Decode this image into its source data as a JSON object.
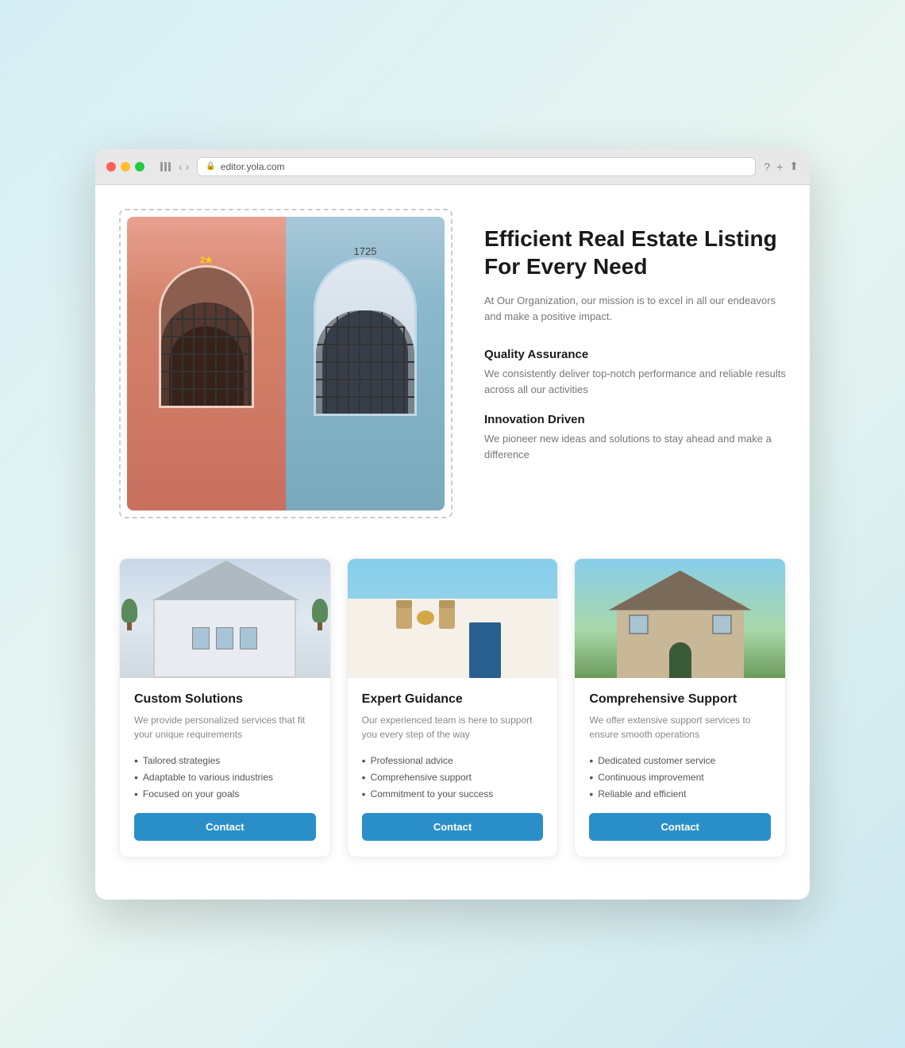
{
  "browser": {
    "url": "editor.yola.com"
  },
  "hero": {
    "title": "Efficient Real Estate Listing For Every Need",
    "subtitle": "At Our Organization, our mission is to excel in all our endeavors and make a positive impact.",
    "feature1": {
      "title": "Quality Assurance",
      "desc": "We consistently deliver top-notch performance and reliable results across all our activities"
    },
    "feature2": {
      "title": "Innovation Driven",
      "desc": "We pioneer new ideas and solutions to stay ahead and make a difference"
    },
    "door_number_right": "1725"
  },
  "cards": [
    {
      "title": "Custom Solutions",
      "desc": "We provide personalized services that fit your unique requirements",
      "items": [
        "Tailored strategies",
        "Adaptable to various industries",
        "Focused on your goals"
      ],
      "btn": "Contact"
    },
    {
      "title": "Expert Guidance",
      "desc": "Our experienced team is here to support you every step of the way",
      "items": [
        "Professional advice",
        "Comprehensive support",
        "Commitment to your success"
      ],
      "btn": "Contact"
    },
    {
      "title": "Comprehensive Support",
      "desc": "We offer extensive support services to ensure smooth operations",
      "items": [
        "Dedicated customer service",
        "Continuous improvement",
        "Reliable and efficient"
      ],
      "btn": "Contact"
    }
  ]
}
